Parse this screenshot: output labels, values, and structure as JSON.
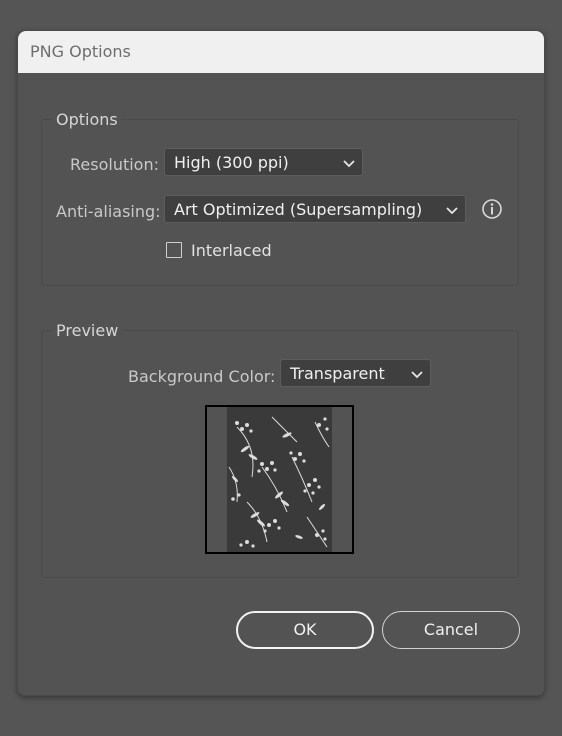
{
  "window": {
    "title": "PNG Options"
  },
  "options": {
    "group_label": "Options",
    "resolution": {
      "label": "Resolution:",
      "value": "High (300 ppi)"
    },
    "anti_aliasing": {
      "label": "Anti-aliasing:",
      "value": "Art Optimized (Supersampling)"
    },
    "interlaced": {
      "label": "Interlaced",
      "checked": false
    }
  },
  "preview": {
    "group_label": "Preview",
    "background_color": {
      "label": "Background Color:",
      "value": "Transparent"
    },
    "thumbnail_desc": "floral-pattern-artwork"
  },
  "buttons": {
    "ok_label": "OK",
    "cancel_label": "Cancel"
  },
  "icons": {
    "dropdown": "chevron-down-icon",
    "info": "info-icon"
  },
  "colors": {
    "dialog_bg": "#535353",
    "titlebar_bg": "#f0f0f0",
    "control_bg": "#3f3f3f",
    "text": "#c9c9c9",
    "artwork_bg": "#3a3a3a",
    "artwork_fg": "#dcdcdc"
  }
}
